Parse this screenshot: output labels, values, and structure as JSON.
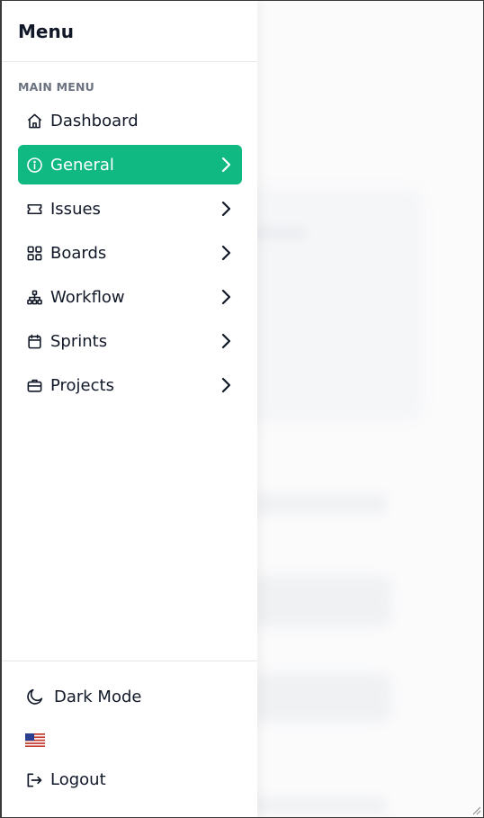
{
  "drawer": {
    "title": "Menu",
    "section_label": "MAIN MENU",
    "items": [
      {
        "label": "Dashboard",
        "icon": "home-icon",
        "has_chevron": false,
        "active": false
      },
      {
        "label": "General",
        "icon": "info-circle-icon",
        "has_chevron": true,
        "active": true
      },
      {
        "label": "Issues",
        "icon": "ticket-icon",
        "has_chevron": true,
        "active": false
      },
      {
        "label": "Boards",
        "icon": "grid-icon",
        "has_chevron": true,
        "active": false
      },
      {
        "label": "Workflow",
        "icon": "hierarchy-icon",
        "has_chevron": true,
        "active": false
      },
      {
        "label": "Sprints",
        "icon": "calendar-icon",
        "has_chevron": true,
        "active": false
      },
      {
        "label": "Projects",
        "icon": "briefcase-icon",
        "has_chevron": true,
        "active": false
      }
    ],
    "bottom": {
      "dark_mode_label": "Dark Mode",
      "dark_mode_icon": "moon-icon",
      "language_icon": "us-flag-icon",
      "logout_label": "Logout",
      "logout_icon": "logout-icon"
    }
  },
  "colors": {
    "accent": "#10b981",
    "text": "#111827",
    "muted": "#6b7280",
    "border": "#e5e7eb"
  }
}
